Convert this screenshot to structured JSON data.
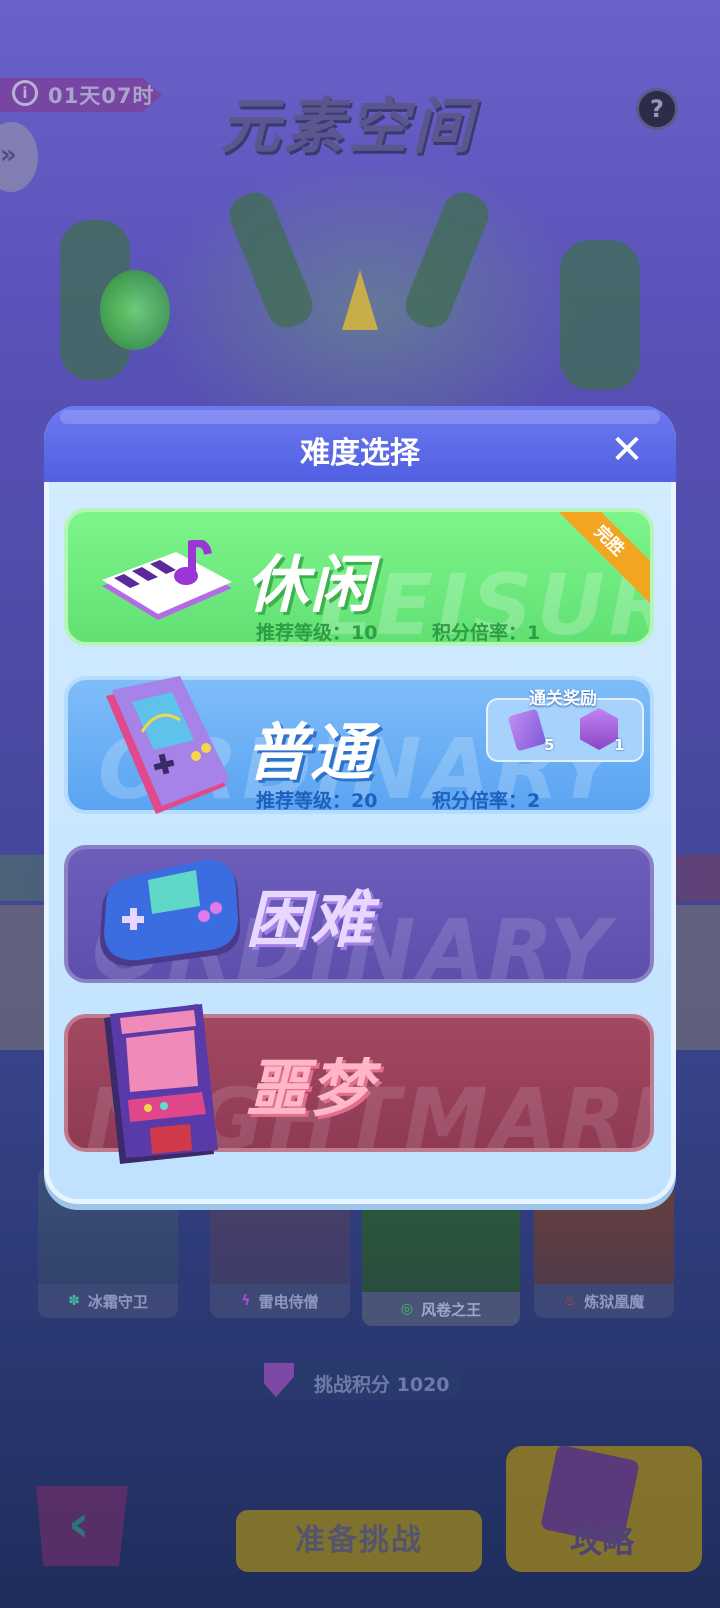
{
  "header": {
    "timer": "01天07时",
    "title": "元素空间",
    "help": "?"
  },
  "bosses": [
    {
      "name": "冰霜守卫",
      "icon": "snowflake-icon"
    },
    {
      "name": "雷电侍僧",
      "icon": "lightning-icon"
    },
    {
      "name": "风卷之王",
      "icon": "wind-icon"
    },
    {
      "name": "炼狱凰魔",
      "icon": "fire-icon"
    }
  ],
  "points": {
    "label": "挑战积分",
    "value": "1020"
  },
  "footer": {
    "ready": "准备挑战",
    "guide": "攻略"
  },
  "modal": {
    "title": "难度选择",
    "close": "✕",
    "options": [
      {
        "name": "休闲",
        "ghost": "LEISURE",
        "level": "推荐等级：10",
        "multiplier": "积分倍率：1",
        "badge": "完胜"
      },
      {
        "name": "普通",
        "ghost": "ORDINARY",
        "level": "推荐等级：20",
        "multiplier": "积分倍率：2",
        "reward": {
          "title": "通关奖励",
          "items": [
            {
              "icon": "ticket-icon",
              "count": "5"
            },
            {
              "icon": "gem-icon",
              "count": "1"
            }
          ]
        }
      },
      {
        "name": "困难",
        "ghost": "ORDINARY"
      },
      {
        "name": "噩梦",
        "ghost": "NIGHTMARE"
      }
    ]
  },
  "colors": {
    "leisure": "#6be87a",
    "ordinary": "#66aef5",
    "hard": "#6657b4",
    "nightmare": "#9a4159",
    "header": "#5a67e6"
  }
}
